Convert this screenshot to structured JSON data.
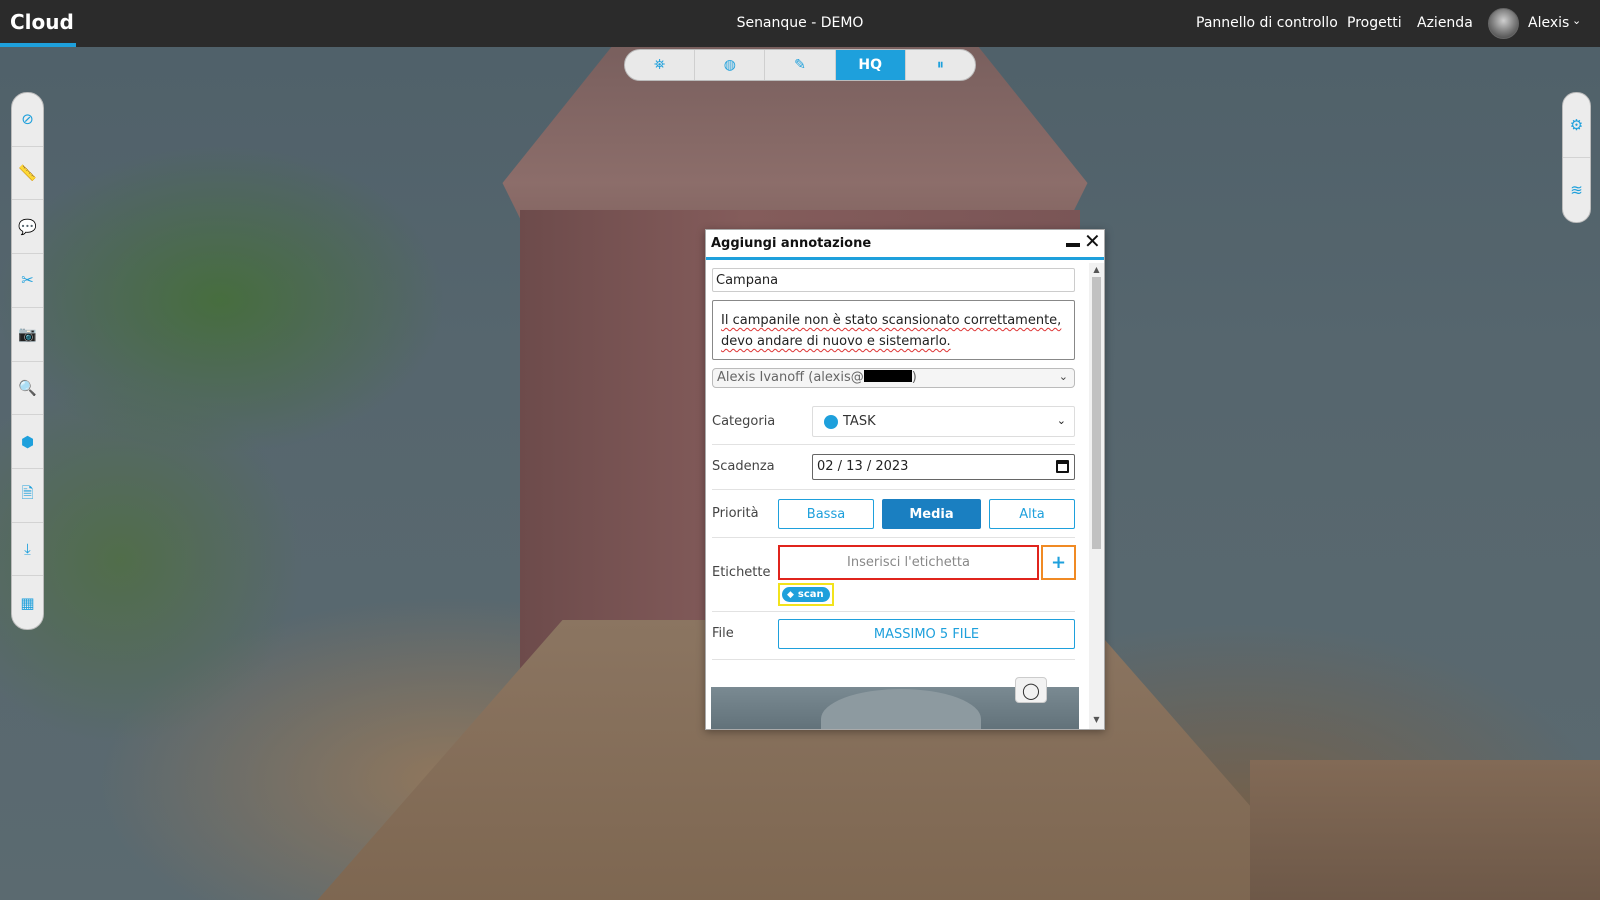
{
  "header": {
    "brand": "Cloud",
    "page_title": "Senanque - DEMO",
    "nav": [
      "Pannello di controllo",
      "Progetti",
      "Azienda"
    ],
    "user_name": "Alexis"
  },
  "top_toolbar": {
    "items": [
      {
        "icon": "binoculars-icon",
        "glyph": "⛯"
      },
      {
        "icon": "globe-icon",
        "glyph": "◍"
      },
      {
        "icon": "brush-icon",
        "glyph": "✎"
      },
      {
        "icon": "hq-toggle",
        "label": "HQ",
        "active": true
      },
      {
        "icon": "pause-icon",
        "glyph": "⏸"
      }
    ]
  },
  "left_toolbar": {
    "items": [
      {
        "icon": "compass-icon",
        "glyph": "⊘"
      },
      {
        "icon": "ruler-icon",
        "glyph": "📏"
      },
      {
        "icon": "comment-icon",
        "glyph": "💬"
      },
      {
        "icon": "scissors-icon",
        "glyph": "✂"
      },
      {
        "icon": "camera-icon",
        "glyph": "📷"
      },
      {
        "icon": "search-icon",
        "glyph": "🔍"
      },
      {
        "icon": "cube-icon",
        "glyph": "⬢"
      },
      {
        "icon": "file-export-icon",
        "glyph": "🗎"
      },
      {
        "icon": "download-icon",
        "glyph": "⤓"
      },
      {
        "icon": "apps-grid-icon",
        "glyph": "▦"
      }
    ]
  },
  "right_toolbar": {
    "items": [
      {
        "icon": "settings-icon",
        "glyph": "⚙"
      },
      {
        "icon": "layers-icon",
        "glyph": "≋"
      }
    ]
  },
  "dialog": {
    "title": "Aggiungi annotazione",
    "title_value": "Campana",
    "description": "Il campanile non è stato scansionato correttamente, devo andare di nuovo e sistemarlo.",
    "assignee": "Alexis Ivanoff (alexis@",
    "assignee_end": ")",
    "category_label": "Categoria",
    "category_value": "TASK",
    "category_color": "#1ea0dc",
    "due_label": "Scadenza",
    "due_value": "02 / 13 / 2023",
    "priority_label": "Priorità",
    "priorities": [
      "Bassa",
      "Media",
      "Alta"
    ],
    "priority_selected": "Media",
    "tags_label": "Etichette",
    "tag_placeholder": "Inserisci l'etichetta",
    "tag_add": "+",
    "tags": [
      "scan"
    ],
    "file_label": "File",
    "file_button": "MASSIMO 5 FILE"
  },
  "colors": {
    "accent": "#1ea0dc",
    "topbar": "#2b2b2b",
    "highlight_red": "#e0241c",
    "highlight_orange": "#f08a24",
    "highlight_yellow": "#f2e31c"
  }
}
